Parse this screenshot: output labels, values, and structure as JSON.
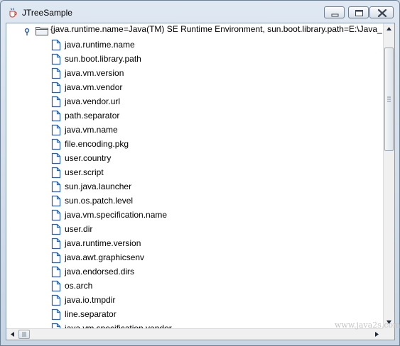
{
  "window": {
    "title": "JTreeSample",
    "app_icon": "java-cup-icon",
    "controls": {
      "minimize": "minimize-icon",
      "maximize": "maximize-icon",
      "close": "close-icon"
    }
  },
  "tree": {
    "root_label": "{java.runtime.name=Java(TM) SE Runtime Environment, sun.boot.library.path=E:\\Java_",
    "root_icon": "folder-icon",
    "handle_icon": "expanded-handle-icon",
    "leaf_icon": "document-icon",
    "items": [
      {
        "label": "java.runtime.name"
      },
      {
        "label": "sun.boot.library.path"
      },
      {
        "label": "java.vm.version"
      },
      {
        "label": "java.vm.vendor"
      },
      {
        "label": "java.vendor.url"
      },
      {
        "label": "path.separator"
      },
      {
        "label": "java.vm.name"
      },
      {
        "label": "file.encoding.pkg"
      },
      {
        "label": "user.country"
      },
      {
        "label": "user.script"
      },
      {
        "label": "sun.java.launcher"
      },
      {
        "label": "sun.os.patch.level"
      },
      {
        "label": "java.vm.specification.name"
      },
      {
        "label": "user.dir"
      },
      {
        "label": "java.runtime.version"
      },
      {
        "label": "java.awt.graphicsenv"
      },
      {
        "label": "java.endorsed.dirs"
      },
      {
        "label": "os.arch"
      },
      {
        "label": "java.io.tmpdir"
      },
      {
        "label": "line.separator"
      },
      {
        "label": "java.vm.specification.vendor"
      }
    ]
  },
  "watermark": "www.java2s.com",
  "colors": {
    "titlebar": "#cfdbe8",
    "icon_blue": "#2f5f9e"
  }
}
